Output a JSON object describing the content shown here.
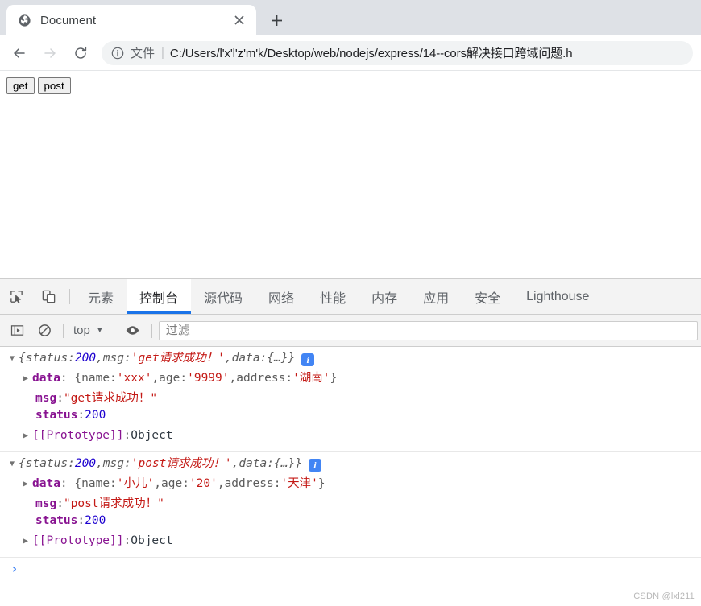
{
  "browser": {
    "tab": {
      "title": "Document",
      "favicon_icon": "globe-icon",
      "close_icon": "close-icon"
    },
    "new_tab_icon": "plus-icon",
    "nav": {
      "back_icon": "arrow-left-icon",
      "forward_icon": "arrow-right-icon",
      "reload_icon": "reload-icon"
    },
    "omnibox": {
      "site_info_icon": "info-circle-icon",
      "scheme_label": "文件",
      "separator": "|",
      "url": "C:/Users/l'x'l'z'm'k/Desktop/web/nodejs/express/14--cors解决接口跨域问题.h"
    }
  },
  "page": {
    "buttons": [
      {
        "label": "get",
        "name": "get-button"
      },
      {
        "label": "post",
        "name": "post-button"
      }
    ]
  },
  "devtools": {
    "inspect_icon": "inspect-element-icon",
    "device_icon": "device-toolbar-icon",
    "tabs": [
      {
        "label": "元素",
        "active": false
      },
      {
        "label": "控制台",
        "active": true
      },
      {
        "label": "源代码",
        "active": false
      },
      {
        "label": "网络",
        "active": false
      },
      {
        "label": "性能",
        "active": false
      },
      {
        "label": "内存",
        "active": false
      },
      {
        "label": "应用",
        "active": false
      },
      {
        "label": "安全",
        "active": false
      },
      {
        "label": "Lighthouse",
        "active": false
      }
    ],
    "console_toolbar": {
      "sidebar_icon": "console-sidebar-icon",
      "clear_icon": "clear-console-icon",
      "context": "top",
      "context_caret": "▼",
      "eye_icon": "live-expression-icon",
      "filter_placeholder": "过滤",
      "filter_value": ""
    },
    "console_messages": [
      {
        "header": {
          "open_triangle": "▼",
          "text_parts": [
            {
              "t": "{",
              "c": "punct"
            },
            {
              "t": "status",
              "c": "key"
            },
            {
              "t": ": ",
              "c": "punct"
            },
            {
              "t": "200",
              "c": "num"
            },
            {
              "t": ", ",
              "c": "punct"
            },
            {
              "t": "msg",
              "c": "key"
            },
            {
              "t": ": ",
              "c": "punct"
            },
            {
              "t": "'get请求成功！'",
              "c": "str"
            },
            {
              "t": ", ",
              "c": "punct"
            },
            {
              "t": "data",
              "c": "key"
            },
            {
              "t": ": ",
              "c": "punct"
            },
            {
              "t": "{…}}",
              "c": "punct"
            }
          ]
        },
        "badge": "i",
        "rows": [
          {
            "indent": 1,
            "triangle": "▶",
            "parts": [
              {
                "t": "data",
                "c": "key-own"
              },
              {
                "t": ": {",
                "c": "punct"
              },
              {
                "t": "name",
                "c": "gray"
              },
              {
                "t": ": ",
                "c": "punct"
              },
              {
                "t": "'xxx'",
                "c": "str"
              },
              {
                "t": ", ",
                "c": "punct"
              },
              {
                "t": "age",
                "c": "gray"
              },
              {
                "t": ": ",
                "c": "punct"
              },
              {
                "t": "'9999'",
                "c": "str"
              },
              {
                "t": ", ",
                "c": "punct"
              },
              {
                "t": "address",
                "c": "gray"
              },
              {
                "t": ": ",
                "c": "punct"
              },
              {
                "t": "'湖南'",
                "c": "str"
              },
              {
                "t": "}",
                "c": "punct"
              }
            ]
          },
          {
            "indent": 2,
            "triangle": "",
            "parts": [
              {
                "t": "msg",
                "c": "key-own"
              },
              {
                "t": ": ",
                "c": "punct"
              },
              {
                "t": "\"get请求成功！\"",
                "c": "str"
              }
            ]
          },
          {
            "indent": 2,
            "triangle": "",
            "parts": [
              {
                "t": "status",
                "c": "key-own"
              },
              {
                "t": ": ",
                "c": "punct"
              },
              {
                "t": "200",
                "c": "num"
              }
            ]
          },
          {
            "indent": 1,
            "triangle": "▶",
            "parts": [
              {
                "t": "[[Prototype]]",
                "c": "proto"
              },
              {
                "t": ": ",
                "c": "punct"
              },
              {
                "t": "Object",
                "c": "object"
              }
            ]
          }
        ]
      },
      {
        "header": {
          "open_triangle": "▼",
          "text_parts": [
            {
              "t": "{",
              "c": "punct"
            },
            {
              "t": "status",
              "c": "key"
            },
            {
              "t": ": ",
              "c": "punct"
            },
            {
              "t": "200",
              "c": "num"
            },
            {
              "t": ", ",
              "c": "punct"
            },
            {
              "t": "msg",
              "c": "key"
            },
            {
              "t": ": ",
              "c": "punct"
            },
            {
              "t": "'post请求成功！'",
              "c": "str"
            },
            {
              "t": ", ",
              "c": "punct"
            },
            {
              "t": "data",
              "c": "key"
            },
            {
              "t": ": ",
              "c": "punct"
            },
            {
              "t": "{…}}",
              "c": "punct"
            }
          ]
        },
        "badge": "i",
        "rows": [
          {
            "indent": 1,
            "triangle": "▶",
            "parts": [
              {
                "t": "data",
                "c": "key-own"
              },
              {
                "t": ": {",
                "c": "punct"
              },
              {
                "t": "name",
                "c": "gray"
              },
              {
                "t": ": ",
                "c": "punct"
              },
              {
                "t": "'小儿'",
                "c": "str"
              },
              {
                "t": ", ",
                "c": "punct"
              },
              {
                "t": "age",
                "c": "gray"
              },
              {
                "t": ": ",
                "c": "punct"
              },
              {
                "t": "'20'",
                "c": "str"
              },
              {
                "t": ", ",
                "c": "punct"
              },
              {
                "t": "address",
                "c": "gray"
              },
              {
                "t": ": ",
                "c": "punct"
              },
              {
                "t": "'天津'",
                "c": "str"
              },
              {
                "t": "}",
                "c": "punct"
              }
            ]
          },
          {
            "indent": 2,
            "triangle": "",
            "parts": [
              {
                "t": "msg",
                "c": "key-own"
              },
              {
                "t": ": ",
                "c": "punct"
              },
              {
                "t": "\"post请求成功！\"",
                "c": "str"
              }
            ]
          },
          {
            "indent": 2,
            "triangle": "",
            "parts": [
              {
                "t": "status",
                "c": "key-own"
              },
              {
                "t": ": ",
                "c": "punct"
              },
              {
                "t": "200",
                "c": "num"
              }
            ]
          },
          {
            "indent": 1,
            "triangle": "▶",
            "parts": [
              {
                "t": "[[Prototype]]",
                "c": "proto"
              },
              {
                "t": ": ",
                "c": "punct"
              },
              {
                "t": "Object",
                "c": "object"
              }
            ]
          }
        ]
      }
    ],
    "prompt_caret": "›"
  },
  "watermark": "CSDN @lxl211",
  "colors": {
    "accent": "#1a73e8",
    "info_badge": "#4285f4",
    "tabstrip_bg": "#dee1e6",
    "devtools_bg": "#f3f3f3",
    "string": "#c41a16",
    "number": "#1c00cf",
    "key": "#881391"
  }
}
